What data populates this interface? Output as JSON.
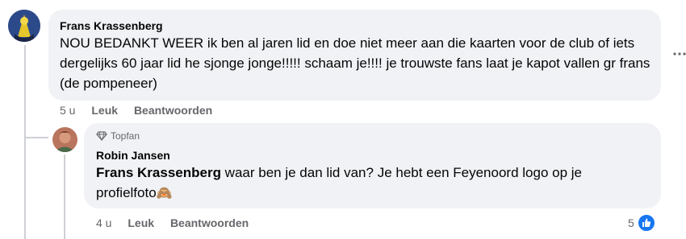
{
  "comments": [
    {
      "author": "Frans Krassenberg",
      "text": "NOU BEDANKT WEER ik ben al jaren lid en doe niet meer aan die kaarten voor de club of iets dergelijks 60 jaar lid he sjonge jonge!!!!! schaam je!!!! je trouwste fans laat je kapot vallen gr frans (de pompeneer)",
      "time": "5 u",
      "like_label": "Leuk",
      "reply_label": "Beantwoorden",
      "more_label": "..."
    },
    {
      "badge": "Topfan",
      "author": "Robin Jansen",
      "mention": "Frans Krassenberg",
      "text": " waar ben je dan lid van? Je hebt een Feyenoord logo op je profielfoto",
      "emoji": "🙈",
      "time": "4 u",
      "like_label": "Leuk",
      "reply_label": "Beantwoorden",
      "reaction_count": "5"
    }
  ],
  "colors": {
    "bubble": "#f0f2f5",
    "secondary_text": "#65676b",
    "like_blue": "#1877f2"
  },
  "icons": [
    "diamond-icon",
    "thumbs-up-icon",
    "more-options-icon"
  ]
}
